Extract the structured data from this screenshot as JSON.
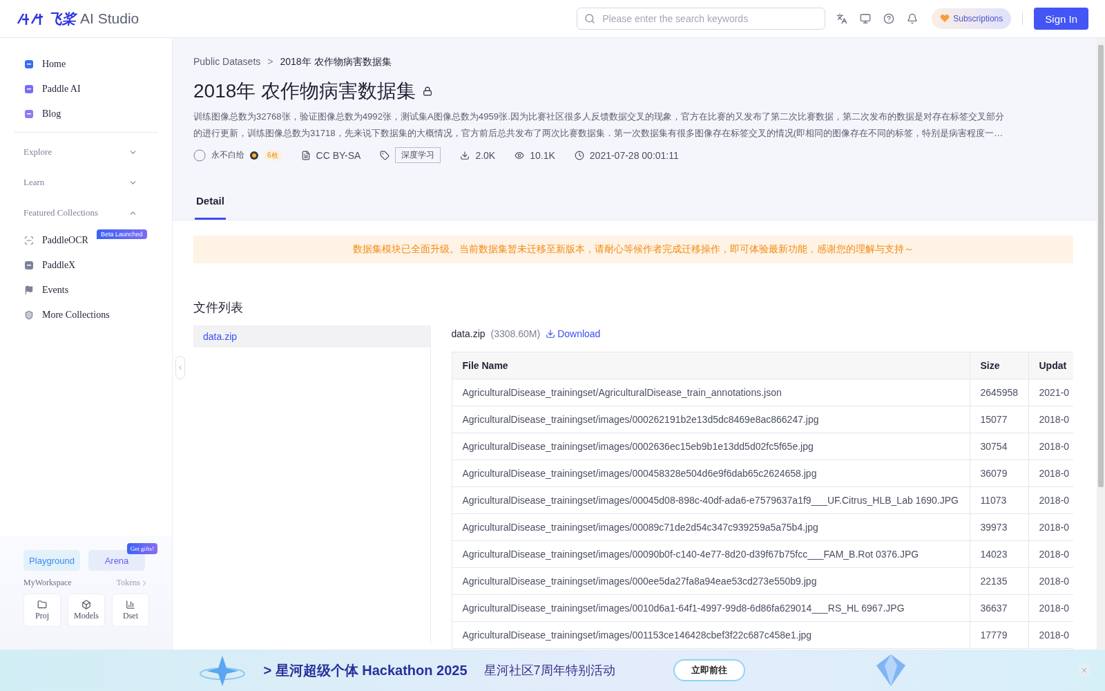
{
  "topbar": {
    "logo_mark": "飞桨",
    "logo_text": "AI Studio",
    "search": {
      "placeholder": "Please enter the search keywords"
    },
    "subscriptions": "Subscriptions",
    "sign_in": "Sign In"
  },
  "sidebar": {
    "items": [
      {
        "label": "Home"
      },
      {
        "label": "Paddle AI"
      },
      {
        "label": "Blog"
      }
    ],
    "sections": [
      {
        "label": "Explore",
        "expanded": false
      },
      {
        "label": "Learn",
        "expanded": false
      },
      {
        "label": "Featured Collections",
        "expanded": true,
        "items": [
          {
            "label": "PaddleOCR",
            "badge": "Beta Launched"
          },
          {
            "label": "PaddleX"
          },
          {
            "label": "Events"
          },
          {
            "label": "More Collections"
          }
        ]
      }
    ],
    "workspace": {
      "buttons": [
        {
          "label": "Playground"
        },
        {
          "label": "Arena",
          "badge": "Get gifts!"
        }
      ],
      "title": "MyWorkspace",
      "tokens": "Tokens",
      "cards": [
        {
          "label": "Proj"
        },
        {
          "label": "Models"
        },
        {
          "label": "Dset"
        }
      ]
    }
  },
  "breadcrumb": [
    "Public Datasets",
    "2018年 农作物病害数据集"
  ],
  "breadcrumb_separator": ">",
  "title": "2018年 农作物病害数据集",
  "description_lines": [
    "训练图像总数为32768张，验证图像总数为4992张，测试集A图像总数为4959张.因为比赛社区很多人反馈数据交叉的现象，官方在比赛的又发布了第二次比赛数据，第二次发布的数据是对存在标签交叉部分",
    "的进行更新，训练图像总数为31718，先来说下数据集的大概情况，官方前后总共发布了两次比赛数据集．第一次数据集有很多图像存在标签交叉的情况(即相同的图像存在不同的标签，特别是病害程度一…"
  ],
  "meta": {
    "author": "永不白给",
    "author_badge": "6枚",
    "license": "CC BY-SA",
    "tag": "深度学习",
    "downloads": "2.0K",
    "views": "10.1K",
    "date": "2021-07-28 00:01:11"
  },
  "tabs": [
    {
      "label": "Detail",
      "selected": true
    }
  ],
  "notice": "数据集模块已全面升级。当前数据集暂未迁移至新版本，请耐心等候作者完成迁移操作，即可体验最新功能，感谢您的理解与支持～",
  "file_list": {
    "title": "文件列表",
    "files": [
      {
        "name": "data.zip",
        "selected": true
      }
    ]
  },
  "file_detail": {
    "name": "data.zip",
    "size": "(3308.60M)",
    "download": "Download"
  },
  "table": {
    "columns": [
      "File Name",
      "Size",
      "Updat"
    ],
    "rows": [
      [
        "AgriculturalDisease_trainingset/AgriculturalDisease_train_annotations.json",
        "2645958",
        "2021-0"
      ],
      [
        "AgriculturalDisease_trainingset/images/000262191b2e13d5dc8469e8ac866247.jpg",
        "15077",
        "2018-0"
      ],
      [
        "AgriculturalDisease_trainingset/images/0002636ec15eb9b1e13dd5d02fc5f65e.jpg",
        "30754",
        "2018-0"
      ],
      [
        "AgriculturalDisease_trainingset/images/000458328e504d6e9f6dab65c2624658.jpg",
        "36079",
        "2018-0"
      ],
      [
        "AgriculturalDisease_trainingset/images/00045d08-898c-40df-ada6-e7579637a1f9___UF.Citrus_HLB_Lab 1690.JPG",
        "11073",
        "2018-0"
      ],
      [
        "AgriculturalDisease_trainingset/images/00089c71de2d54c347c939259a5a75b4.jpg",
        "39973",
        "2018-0"
      ],
      [
        "AgriculturalDisease_trainingset/images/00090b0f-c140-4e77-8d20-d39f67b75fcc___FAM_B.Rot 0376.JPG",
        "14023",
        "2018-0"
      ],
      [
        "AgriculturalDisease_trainingset/images/000ee5da27fa8a94eae53cd273e550b9.jpg",
        "22135",
        "2018-0"
      ],
      [
        "AgriculturalDisease_trainingset/images/0010d6a1-64f1-4997-99d8-6d86fa629014___RS_HL 6967.JPG",
        "36637",
        "2018-0"
      ],
      [
        "AgriculturalDisease_trainingset/images/001153ce146428cbef3f22c687c458e1.jpg",
        "17779",
        "2018-0"
      ]
    ]
  },
  "banner": {
    "headline": "> 星河超级个体 Hackathon 2025",
    "subline": "星河社区7周年特别活动",
    "button": "立即前往"
  }
}
